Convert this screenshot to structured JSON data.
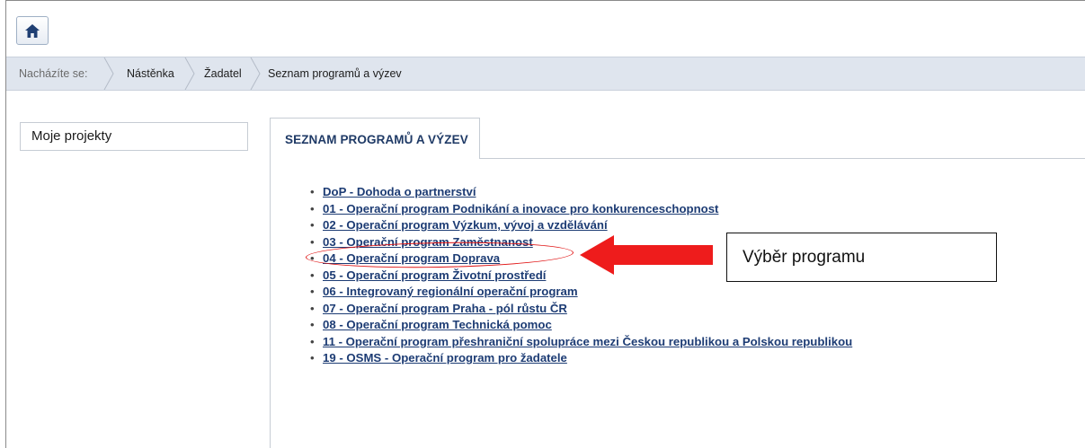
{
  "header": {
    "home_icon": "home-icon"
  },
  "breadcrumb": {
    "lead": "Nacházíte se:",
    "items": [
      "Nástěnka",
      "Žadatel",
      "Seznam programů a výzev"
    ]
  },
  "sidebar": {
    "label": "Moje projekty"
  },
  "main": {
    "tab_label": "SEZNAM PROGRAMŮ A VÝZEV",
    "programs": [
      "DoP - Dohoda o partnerství",
      "01 - Operační program Podnikání a inovace pro konkurenceschopnost",
      "02 - Operační program Výzkum, vývoj a vzdělávání",
      "03 - Operační program Zaměstnanost",
      "04 - Operační program Doprava",
      "05 - Operační program Životní prostředí",
      "06 - Integrovaný regionální operační program",
      "07 - Operační program Praha - pól růstu ČR",
      "08 - Operační program Technická pomoc",
      "11 - Operační program přeshraniční spolupráce mezi Českou republikou a Polskou republikou",
      "19 - OSMS - Operační program pro žadatele"
    ]
  },
  "annotation": {
    "callout_text": "Výběr programu",
    "highlight_color": "#e01010",
    "arrow_color": "#ee1c1c"
  },
  "colors": {
    "link": "#1d3c74",
    "tab_text": "#1f3a66",
    "breadcrumb_bg": "#dfe5ee",
    "home_icon": "#1f3f73"
  }
}
